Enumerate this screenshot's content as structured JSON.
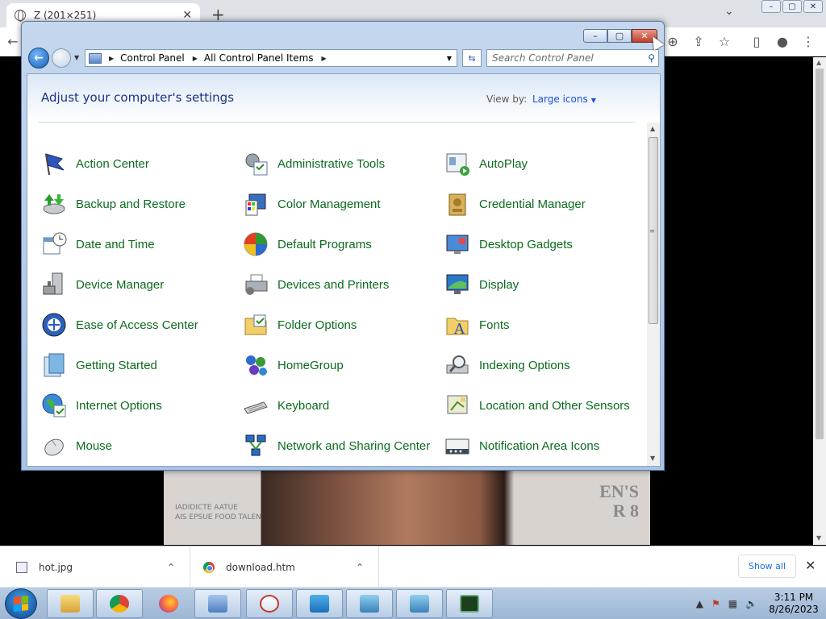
{
  "browser": {
    "tab_title": "Z (201×251)",
    "tab_close": "✕",
    "new_tab": "+",
    "tab_search": "⌄",
    "controls": [
      "–",
      "▢",
      "✕"
    ],
    "toolbar_icons": [
      "zoom-icon",
      "share-icon",
      "star-icon",
      "sidepanel-icon",
      "profile-icon",
      "menu-icon"
    ]
  },
  "photo": {
    "cover_text": "EN'S\nR 8",
    "small_text": "IADIDICTE AATUE\nAIS EPSUE FOOD TALEN"
  },
  "window": {
    "controls": [
      "–",
      "▢",
      "✕"
    ],
    "address": {
      "crumbs": [
        "Control Panel",
        "All Control Panel Items"
      ]
    },
    "search_placeholder": "Search Control Panel",
    "heading": "Adjust your computer's settings",
    "view_by_label": "View by:",
    "view_by_value": "Large icons",
    "items": [
      {
        "label": "Action Center",
        "icon": "flag-icon"
      },
      {
        "label": "Administrative Tools",
        "icon": "admin-tools-icon"
      },
      {
        "label": "AutoPlay",
        "icon": "autoplay-icon"
      },
      {
        "label": "Backup and Restore",
        "icon": "backup-icon"
      },
      {
        "label": "Color Management",
        "icon": "color-management-icon"
      },
      {
        "label": "Credential Manager",
        "icon": "credential-icon"
      },
      {
        "label": "Date and Time",
        "icon": "calendar-clock-icon"
      },
      {
        "label": "Default Programs",
        "icon": "default-programs-icon"
      },
      {
        "label": "Desktop Gadgets",
        "icon": "gadgets-icon"
      },
      {
        "label": "Device Manager",
        "icon": "device-manager-icon"
      },
      {
        "label": "Devices and Printers",
        "icon": "printer-icon"
      },
      {
        "label": "Display",
        "icon": "monitor-icon"
      },
      {
        "label": "Ease of Access Center",
        "icon": "ease-access-icon"
      },
      {
        "label": "Folder Options",
        "icon": "folder-icon"
      },
      {
        "label": "Fonts",
        "icon": "fonts-folder-icon"
      },
      {
        "label": "Getting Started",
        "icon": "getting-started-icon"
      },
      {
        "label": "HomeGroup",
        "icon": "homegroup-icon"
      },
      {
        "label": "Indexing Options",
        "icon": "indexing-icon"
      },
      {
        "label": "Internet Options",
        "icon": "globe-icon"
      },
      {
        "label": "Keyboard",
        "icon": "keyboard-icon"
      },
      {
        "label": "Location and Other Sensors",
        "icon": "location-sensor-icon"
      },
      {
        "label": "Mouse",
        "icon": "mouse-icon"
      },
      {
        "label": "Network and Sharing Center",
        "icon": "network-icon"
      },
      {
        "label": "Notification Area Icons",
        "icon": "notification-icon"
      }
    ]
  },
  "downloads": {
    "items": [
      {
        "name": "hot.jpg"
      },
      {
        "name": "download.htm"
      }
    ],
    "show_all": "Show all",
    "close": "✕"
  },
  "taskbar": {
    "time": "3:11 PM",
    "date": "8/26/2023",
    "buttons": [
      "explorer",
      "chrome",
      "firefox",
      "control-panel",
      "snipping-tool",
      "display",
      "photo-viewer-1",
      "photo-viewer-2",
      "task-manager"
    ]
  }
}
